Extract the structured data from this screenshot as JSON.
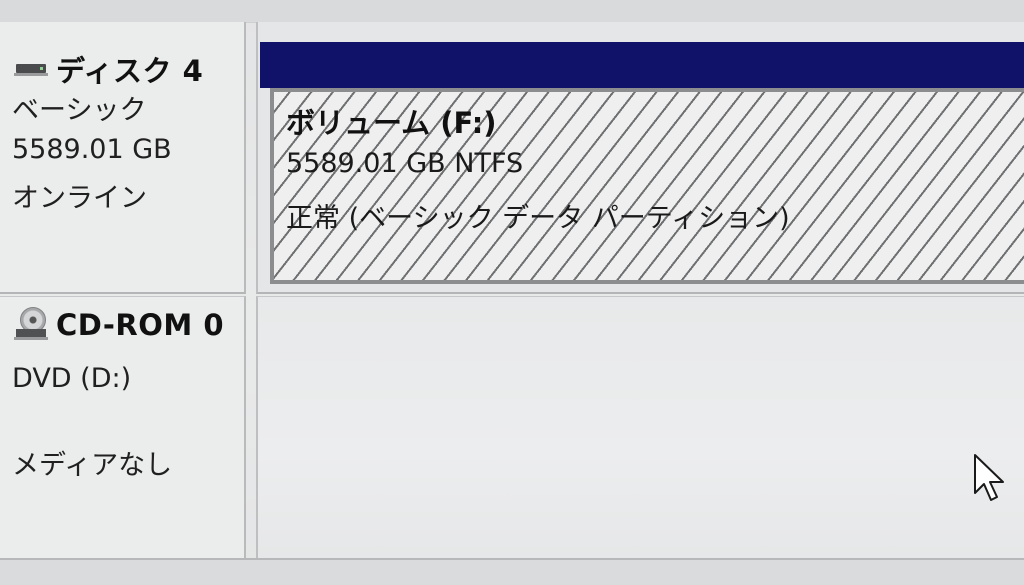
{
  "disks": [
    {
      "title": "ディスク 4",
      "icon": "hard-disk-icon",
      "type": "ベーシック",
      "size": "5589.01 GB",
      "status": "オンライン",
      "volume": {
        "name": "ボリューム (F:)",
        "size_fs": "5589.01 GB NTFS",
        "status": "正常 (ベーシック データ パーティション)"
      }
    },
    {
      "title": "CD-ROM 0",
      "icon": "cd-drive-icon",
      "drive": "DVD (D:)",
      "status": "メディアなし"
    }
  ],
  "colors": {
    "volume_header": "#0f1268",
    "hatch": "#6f7072",
    "background": "#e6e7e8"
  }
}
